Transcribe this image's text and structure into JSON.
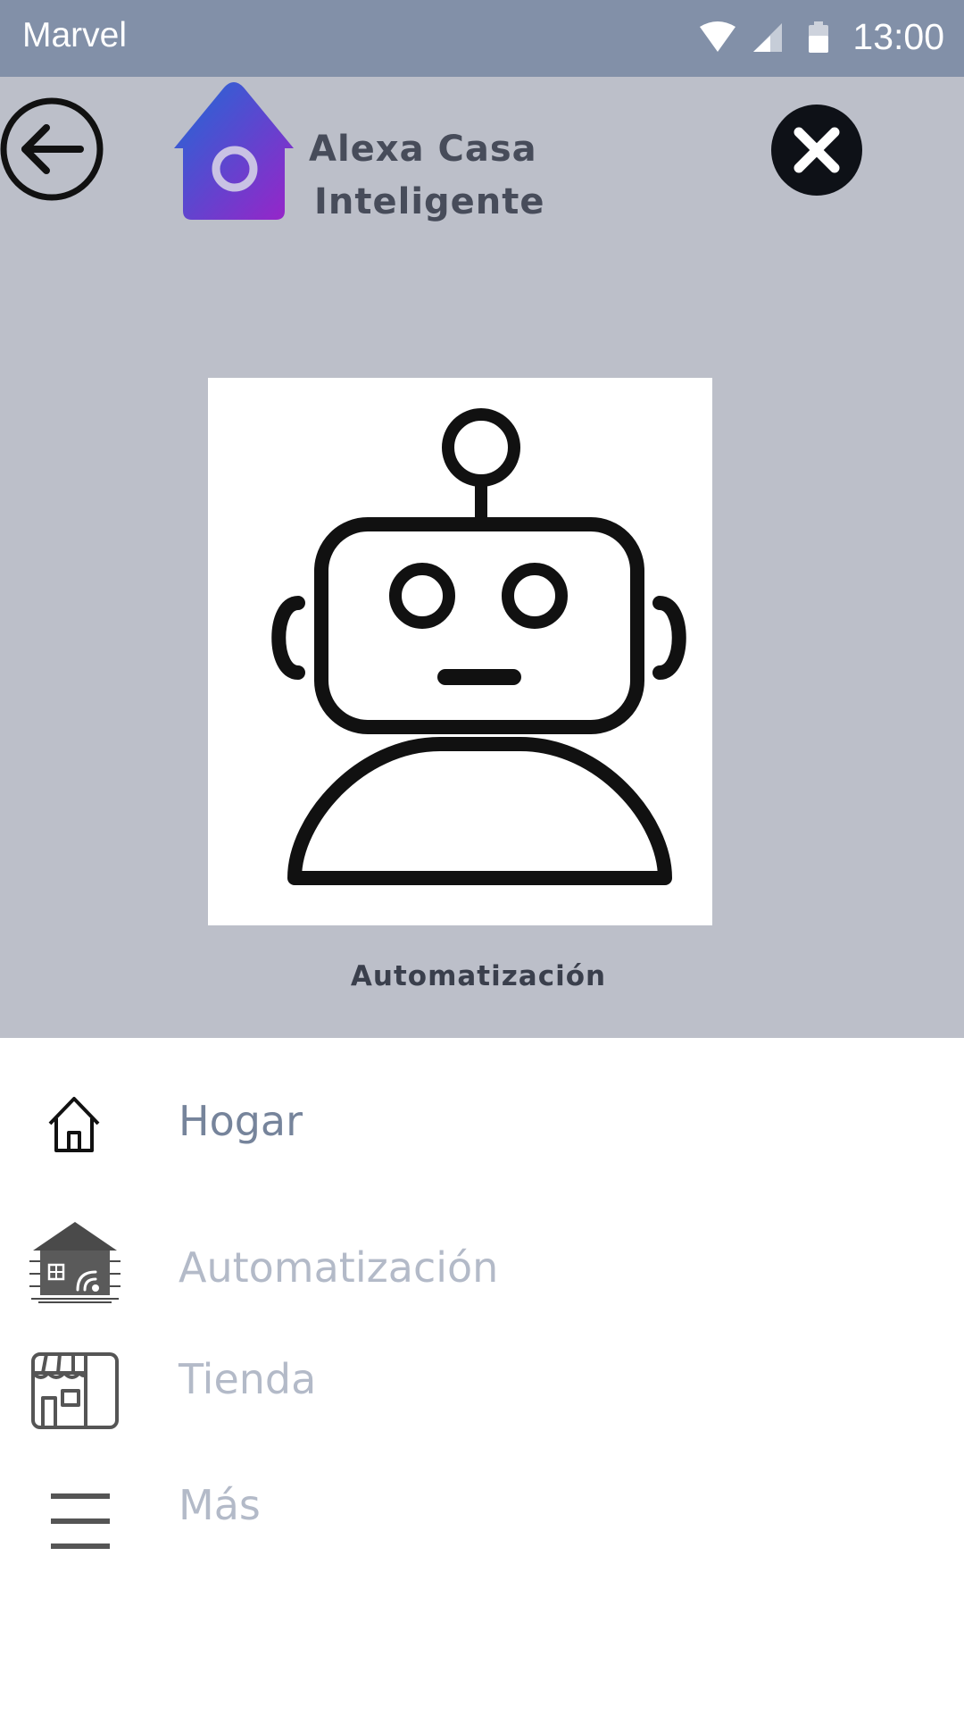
{
  "statusbar": {
    "carrier": "Marvel",
    "time": "13:00",
    "icons": [
      "wifi-icon",
      "signal-icon",
      "battery-icon"
    ]
  },
  "header": {
    "title_line1": "Alexa Casa",
    "title_line2": "Inteligente",
    "back_icon": "arrow-left-circle-icon",
    "close_icon": "close-circle-icon",
    "logo_icon": "home-logo-icon"
  },
  "feature": {
    "image_icon": "robot-icon",
    "caption": "Automatización"
  },
  "menu": {
    "items": [
      {
        "label": "Hogar",
        "icon": "home-outline-icon",
        "active": true
      },
      {
        "label": "Automatización",
        "icon": "smart-house-icon",
        "active": false
      },
      {
        "label": "Tienda",
        "icon": "store-icon",
        "active": false
      },
      {
        "label": "Más",
        "icon": "menu-icon",
        "active": false
      }
    ]
  },
  "colors": {
    "statusbar_bg": "#8290a8",
    "header_bg": "#bcbfc9",
    "active_label": "#76849b",
    "inactive_label": "#b3bac8",
    "logo_gradient_start": "#1f6ad6",
    "logo_gradient_end": "#9a23c8"
  }
}
